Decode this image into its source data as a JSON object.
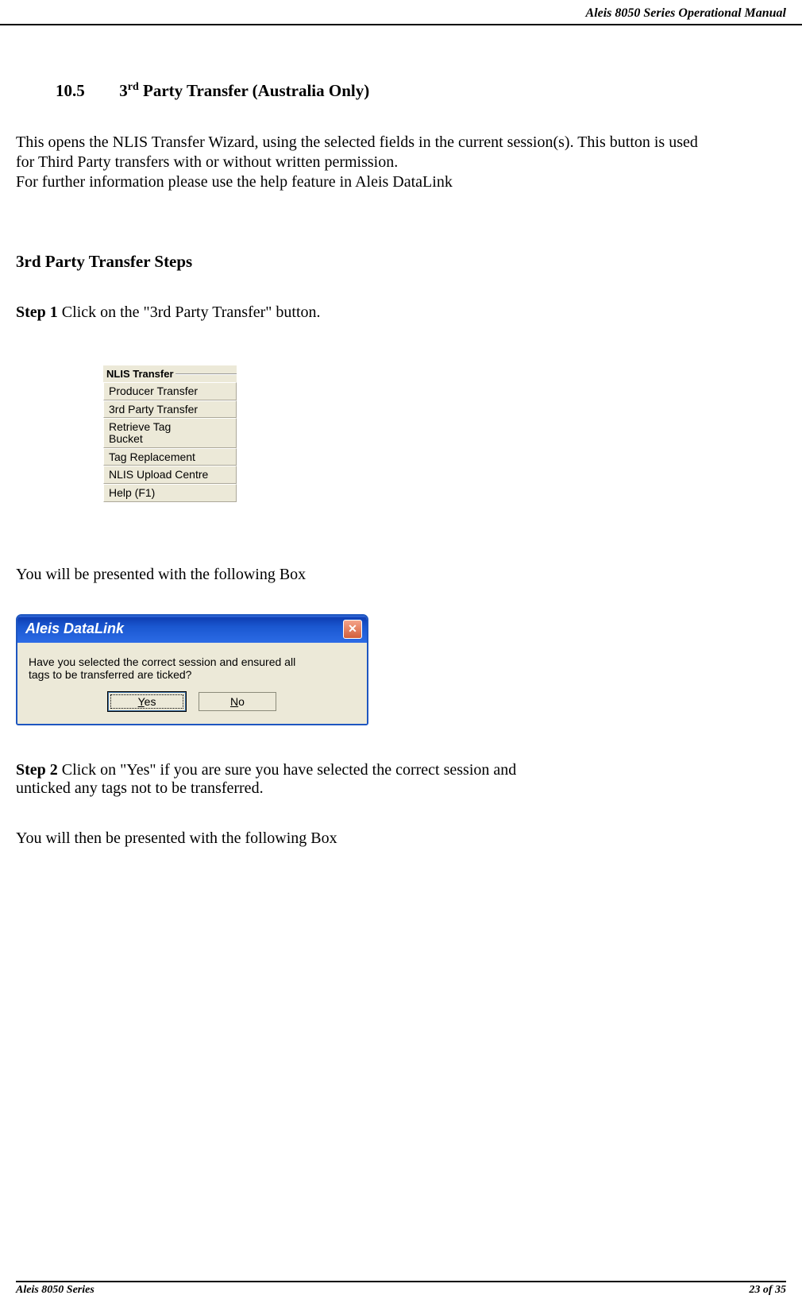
{
  "header": {
    "manual_title": "Aleis 8050 Series Operational Manual"
  },
  "section": {
    "number": "10.5",
    "title_prefix": "3",
    "title_sup": "rd",
    "title_rest": " Party Transfer (Australia Only)"
  },
  "intro": {
    "line1": "This opens the NLIS Transfer Wizard, using the selected fields in the current session(s). This button is used",
    "line2": "for Third Party transfers with or without written permission.",
    "line3": "For further information please use the help feature in Aleis DataLink"
  },
  "steps_heading": "3rd Party Transfer Steps",
  "step1": {
    "label": "Step 1",
    "text": " Click on the \"3rd Party Transfer\" button."
  },
  "toolbar": {
    "title": "NLIS Transfer",
    "items": [
      "Producer Transfer",
      "3rd Party Transfer",
      "Retrieve Tag Bucket",
      "Tag Replacement",
      "NLIS Upload Centre",
      "Help (F1)"
    ]
  },
  "after_toolbar": "You will be presented with the following Box",
  "dialog": {
    "title": "Aleis DataLink",
    "message_line1": "Have you selected the correct session and ensured all",
    "message_line2": "tags to be transferred are ticked?",
    "yes": "Yes",
    "no": "No"
  },
  "step2": {
    "label": "Step 2",
    "text_line1": " Click on \"Yes\" if you are sure you have selected the correct session and",
    "text_line2": "unticked any tags not to be transferred."
  },
  "after_step2": "You will then be presented with the following Box",
  "footer": {
    "left": "Aleis 8050 Series",
    "right": "23 of 35"
  }
}
